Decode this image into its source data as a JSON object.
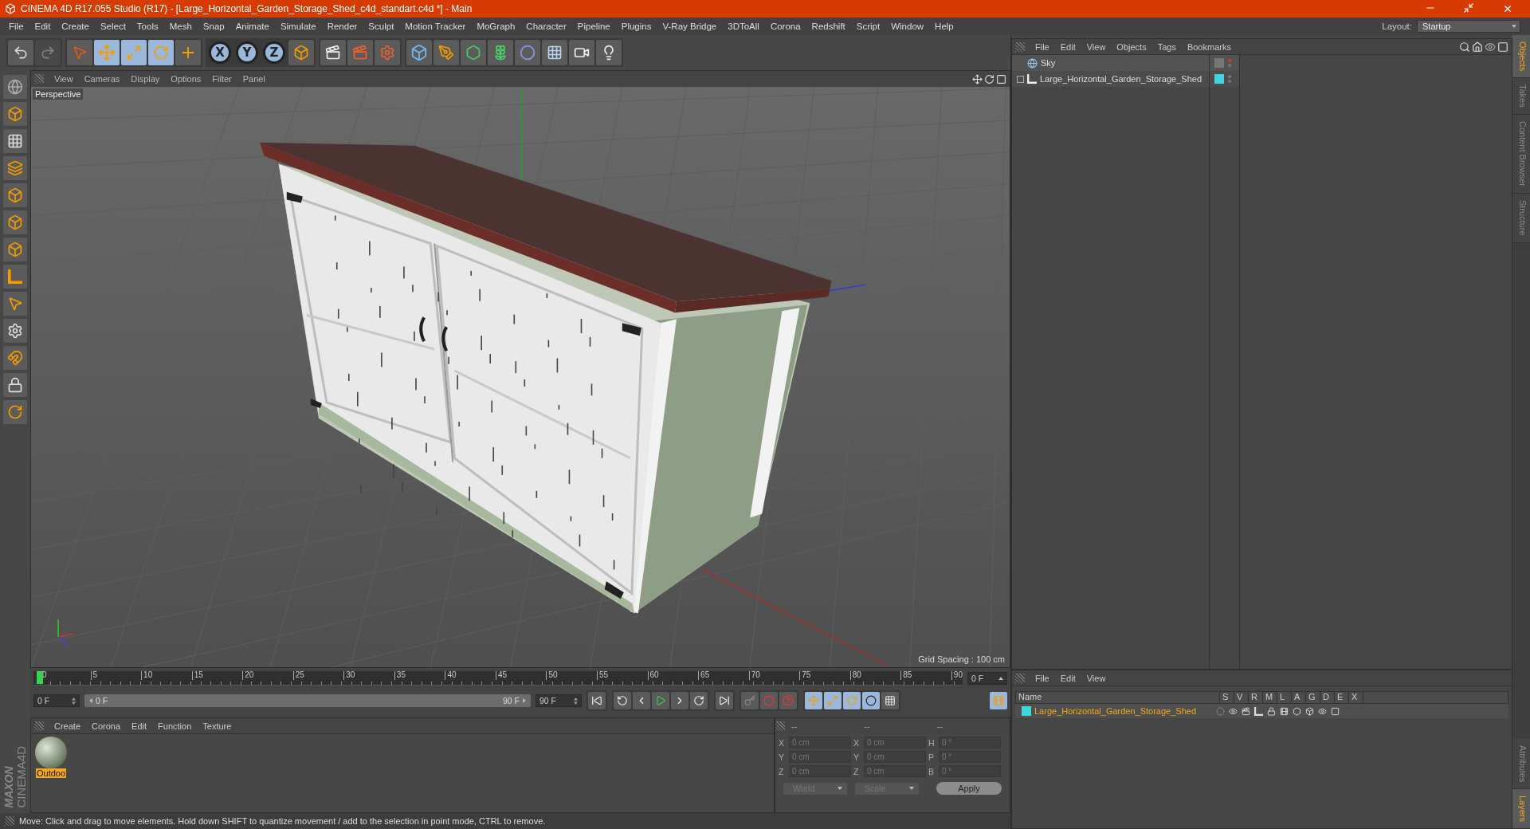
{
  "window": {
    "title": "CINEMA 4D R17.055 Studio (R17) - [Large_Horizontal_Garden_Storage_Shed_c4d_standart.c4d *] - Main",
    "layout_label": "Layout:",
    "layout_value": "Startup"
  },
  "menu": [
    "File",
    "Edit",
    "Create",
    "Select",
    "Tools",
    "Mesh",
    "Snap",
    "Animate",
    "Simulate",
    "Render",
    "Sculpt",
    "Motion Tracker",
    "MoGraph",
    "Character",
    "Pipeline",
    "Plugins",
    "V-Ray Bridge",
    "3DToAll",
    "Corona",
    "Redshift",
    "Script",
    "Window",
    "Help"
  ],
  "history": [
    {
      "kind": "undo",
      "disabled": false
    },
    {
      "kind": "redo",
      "disabled": true
    }
  ],
  "modes": [
    {
      "kind": "select",
      "selected": false
    },
    {
      "kind": "move",
      "selected": true
    },
    {
      "kind": "scale",
      "selected": true
    },
    {
      "kind": "rotate",
      "selected": true
    },
    {
      "kind": "transform",
      "selected": false
    }
  ],
  "axes": [
    {
      "label": "X",
      "selected": true
    },
    {
      "label": "Y",
      "selected": true
    },
    {
      "label": "Z",
      "selected": true
    }
  ],
  "viewport": {
    "menu": [
      "View",
      "Cameras",
      "Display",
      "Options",
      "Filter",
      "Panel"
    ],
    "camera": "Perspective",
    "grid_spacing": "Grid Spacing : 100 cm"
  },
  "timeline": {
    "ticks": [
      "0",
      "5",
      "10",
      "15",
      "20",
      "25",
      "30",
      "35",
      "40",
      "45",
      "50",
      "55",
      "60",
      "65",
      "70",
      "75",
      "80",
      "85",
      "90"
    ],
    "current": "0 F",
    "start": "0 F",
    "range_start": "0 F",
    "range_end": "90 F",
    "end": "90 F",
    "range": {
      "level": 1
    }
  },
  "materials": {
    "menu": [
      "Create",
      "Corona",
      "Edit",
      "Function",
      "Texture"
    ],
    "items": [
      {
        "name": "Outdoo",
        "selected": true
      }
    ]
  },
  "logo": {
    "brand": "MAXON",
    "product": "CINEMA4D"
  },
  "coordinates": {
    "headers": [
      "--",
      "--",
      "--"
    ],
    "rows": [
      {
        "axis": "X",
        "position": "0 cm",
        "size_axis": "X",
        "size": "0 cm",
        "rot_axis": "H",
        "rotation": "0 °"
      },
      {
        "axis": "Y",
        "position": "0 cm",
        "size_axis": "Y",
        "size": "0 cm",
        "rot_axis": "P",
        "rotation": "0 °"
      },
      {
        "axis": "Z",
        "position": "0 cm",
        "size_axis": "Z",
        "size": "0 cm",
        "rot_axis": "B",
        "rotation": "0 °"
      }
    ],
    "mode": "World",
    "transform": "Scale",
    "apply": "Apply"
  },
  "status_bar": "Move: Click and drag to move elements. Hold down SHIFT to quantize movement / add to the selection in point mode, CTRL to remove.",
  "objects": {
    "menu": [
      "File",
      "Edit",
      "View",
      "Objects",
      "Tags",
      "Bookmarks"
    ],
    "items": [
      {
        "name": "Sky",
        "kind": "sky",
        "collapsed": false
      },
      {
        "name": "Large_Horizontal_Garden_Storage_Shed",
        "kind": "null",
        "collapsed": true,
        "color": "#3fd6dd"
      }
    ]
  },
  "layers": {
    "menu": [
      "File",
      "Edit",
      "View"
    ],
    "columns": [
      "Name",
      "S",
      "V",
      "R",
      "M",
      "L",
      "A",
      "G",
      "D",
      "E",
      "X"
    ],
    "rows": [
      {
        "name": "Large_Horizontal_Garden_Storage_Shed",
        "color": "#3fd6dd"
      }
    ]
  },
  "side_tabs": [
    {
      "label": "Objects",
      "selected": true
    },
    {
      "label": "Takes",
      "selected": false
    },
    {
      "label": "Content Browser",
      "selected": false
    },
    {
      "label": "Structure",
      "selected": false
    }
  ],
  "bottom_tabs": [
    {
      "label": "Attributes",
      "selected": false
    },
    {
      "label": "Layers",
      "selected": true
    }
  ]
}
